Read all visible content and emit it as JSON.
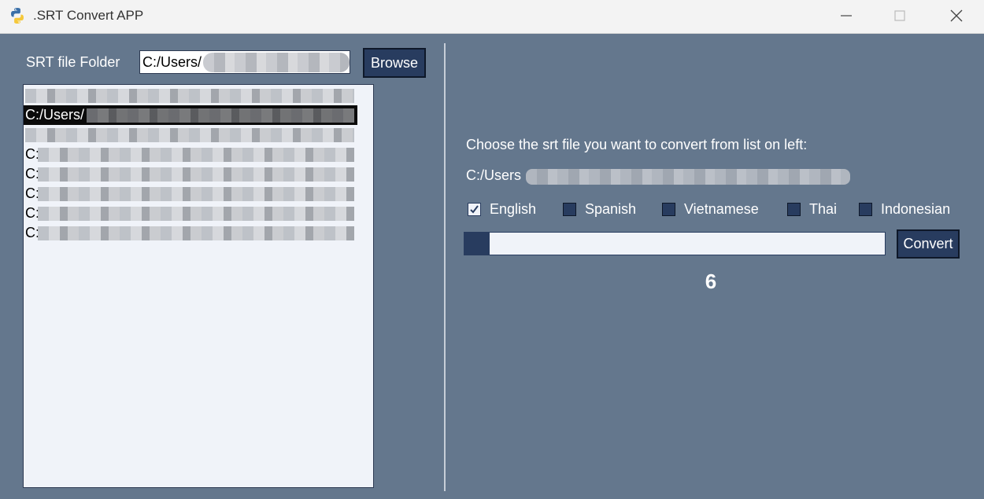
{
  "window": {
    "title": ".SRT Convert APP",
    "app_icon": "python-icon",
    "controls": [
      "minimize-icon",
      "maximize-icon",
      "close-icon"
    ]
  },
  "left_panel": {
    "folder_label": "SRT file Folder",
    "folder_value": "C:/Users/",
    "browse_label": "Browse",
    "file_list": [
      {
        "text": "",
        "selected": false
      },
      {
        "text": "C:/Users/",
        "selected": true
      },
      {
        "text": "",
        "selected": false
      },
      {
        "text": "C:",
        "selected": false
      },
      {
        "text": "C:",
        "selected": false
      },
      {
        "text": "C:",
        "selected": false
      },
      {
        "text": "C:",
        "selected": false
      },
      {
        "text": "C:",
        "selected": false
      }
    ]
  },
  "right_panel": {
    "instruction": "Choose the srt file you want to convert from list on left:",
    "selected_path": "C:/Users",
    "languages": [
      {
        "label": "English",
        "checked": true
      },
      {
        "label": "Spanish",
        "checked": false
      },
      {
        "label": "Vietnamese",
        "checked": false
      },
      {
        "label": "Thai",
        "checked": false
      },
      {
        "label": "Indonesian",
        "checked": false
      }
    ],
    "progress_percent": 6,
    "convert_label": "Convert",
    "counter": "6"
  },
  "colors": {
    "background": "#64778d",
    "accent": "#283c5f",
    "list_background": "#f0f3f9"
  }
}
